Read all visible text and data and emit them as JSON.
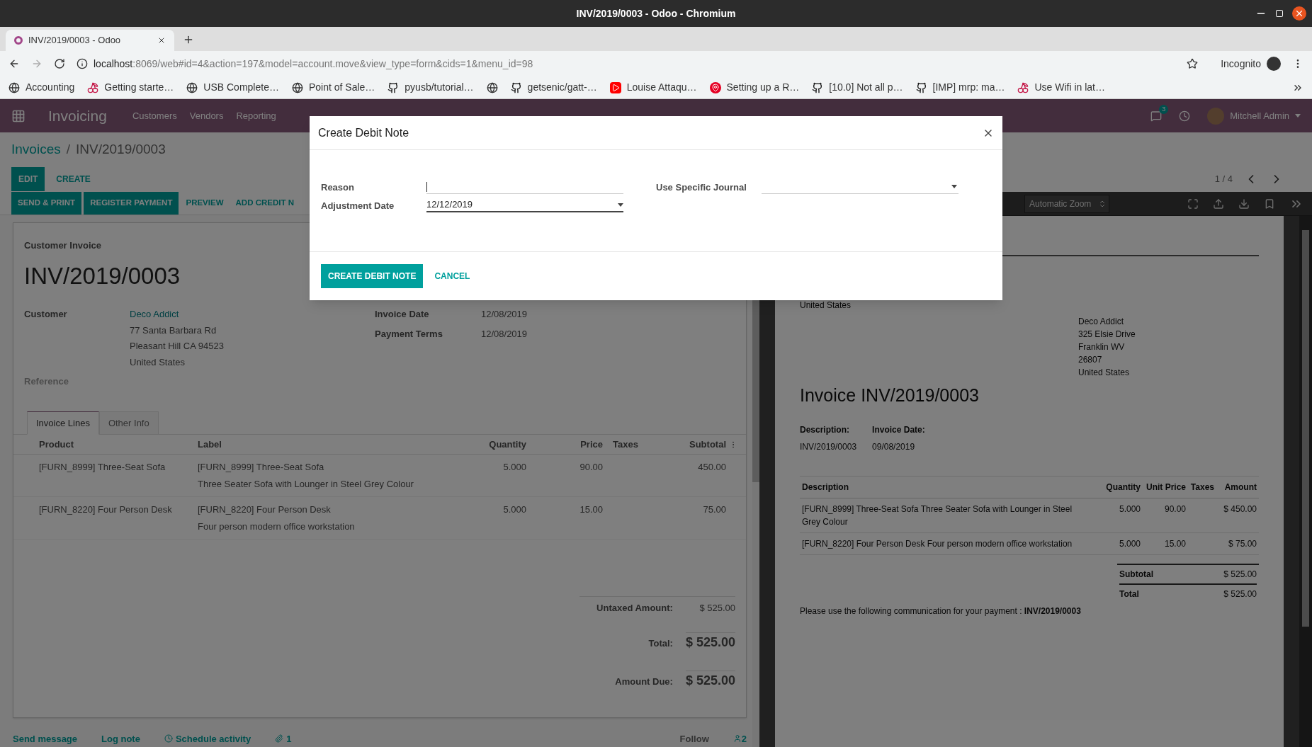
{
  "browser": {
    "title": "INV/2019/0003 - Odoo - Chromium",
    "tab_title": "INV/2019/0003 - Odoo",
    "url_host": "localhost",
    "url_rest": ":8069/web#id=4&action=197&model=account.move&view_type=form&cids=1&menu_id=98",
    "profile": "Incognito",
    "bookmarks": [
      {
        "kind": "globe",
        "label": "Accounting"
      },
      {
        "kind": "berry",
        "label": "Getting starte…"
      },
      {
        "kind": "globe",
        "label": "USB Complete…"
      },
      {
        "kind": "globe",
        "label": "Point of Sale…"
      },
      {
        "kind": "github",
        "label": "pyusb/tutorial…"
      },
      {
        "kind": "globe"
      },
      {
        "kind": "github",
        "label": "getsenic/gatt-…"
      },
      {
        "kind": "video",
        "label": "Louise Attaqu…"
      },
      {
        "kind": "pin",
        "label": "Setting up a R…"
      },
      {
        "kind": "github",
        "label": "[10.0] Not all p…"
      },
      {
        "kind": "github",
        "label": "[IMP] mrp: ma…"
      },
      {
        "kind": "berry",
        "label": "Use Wifi in lat…"
      }
    ]
  },
  "app": {
    "brand": "Invoicing",
    "menu": [
      "Customers",
      "Vendors",
      "Reporting"
    ],
    "messages": "3",
    "user": "Mitchell Admin"
  },
  "breadcrumb": {
    "parent": "Invoices",
    "separator": "/",
    "current": "INV/2019/0003"
  },
  "controls": {
    "edit": "EDIT",
    "create": "CREATE",
    "pager": "1 / 4",
    "actions": [
      {
        "kind": "primary",
        "label": "SEND & PRINT"
      },
      {
        "kind": "primary",
        "label": "REGISTER PAYMENT"
      },
      {
        "kind": "link",
        "label": "PREVIEW"
      },
      {
        "kind": "link",
        "label": "ADD CREDIT N"
      }
    ]
  },
  "form": {
    "type_label": "Customer Invoice",
    "number": "INV/2019/0003",
    "customer_label": "Customer",
    "customer": "Deco Addict",
    "address": [
      "77 Santa Barbara Rd",
      "Pleasant Hill CA 94523",
      "United States"
    ],
    "reference_label": "Reference",
    "fields": [
      {
        "label": "Invoice Date",
        "value": "12/08/2019"
      },
      {
        "label": "Payment Terms",
        "value": "12/08/2019"
      }
    ],
    "tabs": [
      {
        "label": "Invoice Lines",
        "selected": true
      },
      {
        "label": "Other Info",
        "selected": false
      }
    ],
    "columns": [
      "Product",
      "Label",
      "Quantity",
      "Price",
      "Taxes",
      "Subtotal"
    ],
    "rows": [
      {
        "product": "[FURN_8999] Three-Seat Sofa",
        "label": "[FURN_8999] Three-Seat Sofa",
        "description": "Three Seater Sofa with Lounger in Steel Grey Colour",
        "quantity": "5.000",
        "price": "90.00",
        "subtotal": "450.00"
      },
      {
        "product": "[FURN_8220] Four Person Desk",
        "label": "[FURN_8220] Four Person Desk",
        "description": "Four person modern office workstation",
        "quantity": "5.000",
        "price": "15.00",
        "subtotal": "75.00"
      }
    ],
    "untaxed_label": "Untaxed Amount:",
    "untaxed": "$ 525.00",
    "total_label": "Total:",
    "total": "$ 525.00",
    "due_label": "Amount Due:",
    "due": "$ 525.00"
  },
  "chatter": {
    "send": "Send message",
    "log": "Log note",
    "schedule": "Schedule activity",
    "attachments": "1",
    "follow": "Follow",
    "followers": "2"
  },
  "pdf": {
    "zoom": "Automatic Zoom",
    "partial": "United States",
    "address": [
      "Deco Addict",
      "325 Elsie Drive",
      "Franklin WV",
      "26807",
      "United States"
    ],
    "title": "Invoice INV/2019/0003",
    "meta": [
      {
        "label": "Description:",
        "value": "INV/2019/0003"
      },
      {
        "label": "Invoice Date:",
        "value": "09/08/2019"
      }
    ],
    "columns": [
      "Description",
      "Quantity",
      "Unit Price",
      "Taxes",
      "Amount"
    ],
    "rows": [
      {
        "description": "[FURN_8999] Three-Seat Sofa Three Seater Sofa with Lounger in Steel Grey Colour",
        "quantity": "5.000",
        "price": "90.00",
        "amount": "$ 450.00"
      },
      {
        "description": "[FURN_8220] Four Person Desk Four person modern office workstation",
        "quantity": "5.000",
        "price": "15.00",
        "amount": "$ 75.00"
      }
    ],
    "subtotal_label": "Subtotal",
    "subtotal": "$ 525.00",
    "total_label": "Total",
    "total": "$ 525.00",
    "communication": "Please use the following communication for your payment : **INV/2019/0003**"
  },
  "modal": {
    "title": "Create Debit Note",
    "reason_label": "Reason",
    "date_label": "Adjustment Date",
    "date": "12/12/2019",
    "journal_label": "Use Specific Journal",
    "confirm": "CREATE DEBIT NOTE",
    "cancel": "CANCEL"
  }
}
